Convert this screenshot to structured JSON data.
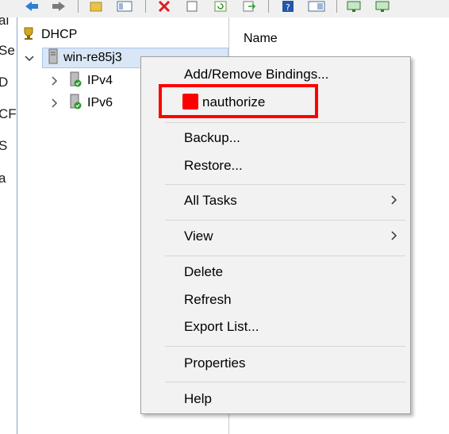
{
  "tree": {
    "root_label": "DHCP",
    "server_label": "win-re85j3",
    "ipv4_label": "IPv4",
    "ipv6_label": "IPv6"
  },
  "left_clip": {
    "lines": [
      "al",
      "Se",
      "D",
      "CF",
      "S",
      "a"
    ]
  },
  "right_pane": {
    "column_header": "Name"
  },
  "context_menu": {
    "items": [
      {
        "label": "Add/Remove Bindings...",
        "submenu": false
      },
      {
        "label": "nauthorize",
        "submenu": false
      },
      {
        "label": "Backup...",
        "submenu": false
      },
      {
        "label": "Restore...",
        "submenu": false
      },
      {
        "label": "All Tasks",
        "submenu": true
      },
      {
        "label": "View",
        "submenu": true
      },
      {
        "label": "Delete",
        "submenu": false
      },
      {
        "label": "Refresh",
        "submenu": false
      },
      {
        "label": "Export List...",
        "submenu": false
      },
      {
        "label": "Properties",
        "submenu": false
      },
      {
        "label": "Help",
        "submenu": false
      }
    ]
  },
  "colors": {
    "highlight": "#ff0000",
    "menu_bg": "#f2f2f2",
    "selection_bg": "#d9e6f5"
  },
  "icons": [
    "back-icon",
    "forward-icon",
    "folder-icon",
    "properties-icon",
    "delete-icon",
    "copy-icon",
    "refresh-icon",
    "export-icon",
    "help-icon",
    "show-pane-icon",
    "server-up-icon",
    "server-down-icon",
    "trophy-icon",
    "server-icon",
    "scope-icon",
    "chevron-right-icon",
    "chevron-down-icon"
  ]
}
